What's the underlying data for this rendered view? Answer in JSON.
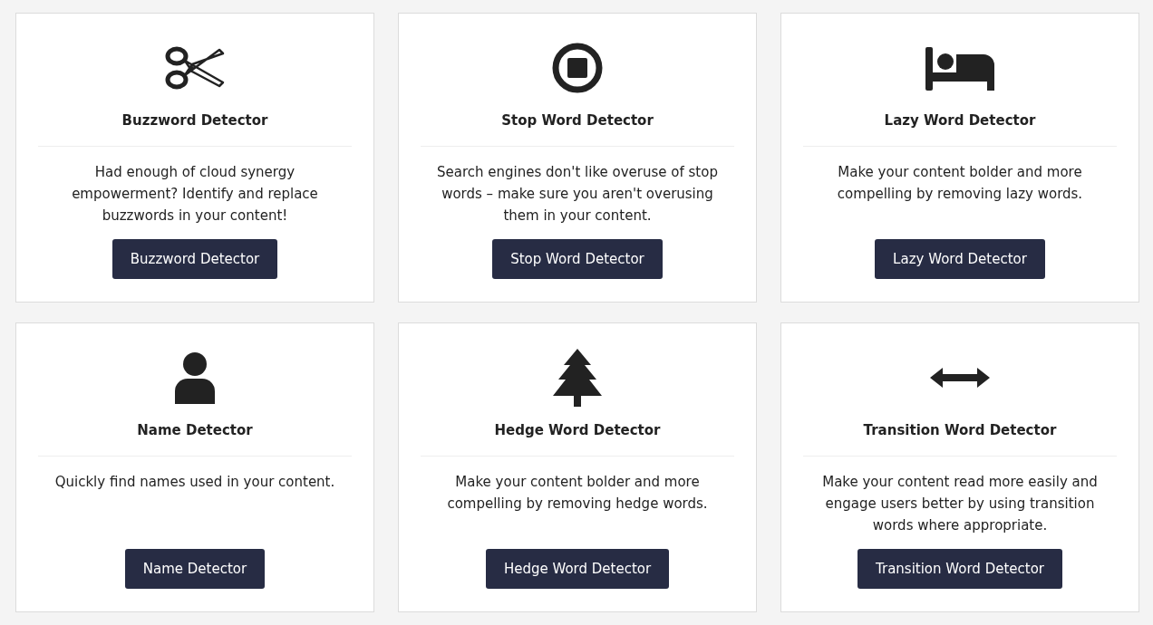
{
  "cards": [
    {
      "kind": "scissors",
      "title": "Buzzword Detector",
      "description": "Had enough of cloud synergy empowerment? Identify and replace buzzwords in your content!",
      "button": "Buzzword Detector"
    },
    {
      "kind": "stop",
      "title": "Stop Word Detector",
      "description": "Search engines don't like overuse of stop words – make sure you aren't overusing them in your content.",
      "button": "Stop Word Detector"
    },
    {
      "kind": "bed",
      "title": "Lazy Word Detector",
      "description": "Make your content bolder and more compelling by removing lazy words.",
      "button": "Lazy Word Detector"
    },
    {
      "kind": "user",
      "title": "Name Detector",
      "description": "Quickly find names used in your content.",
      "button": "Name Detector"
    },
    {
      "kind": "tree",
      "title": "Hedge Word Detector",
      "description": "Make your content bolder and more compelling by removing hedge words.",
      "button": "Hedge Word Detector"
    },
    {
      "kind": "arrows",
      "title": "Transition Word Detector",
      "description": "Make your content read more easily and engage users better by using transition words where appropriate.",
      "button": "Transition Word Detector"
    }
  ]
}
